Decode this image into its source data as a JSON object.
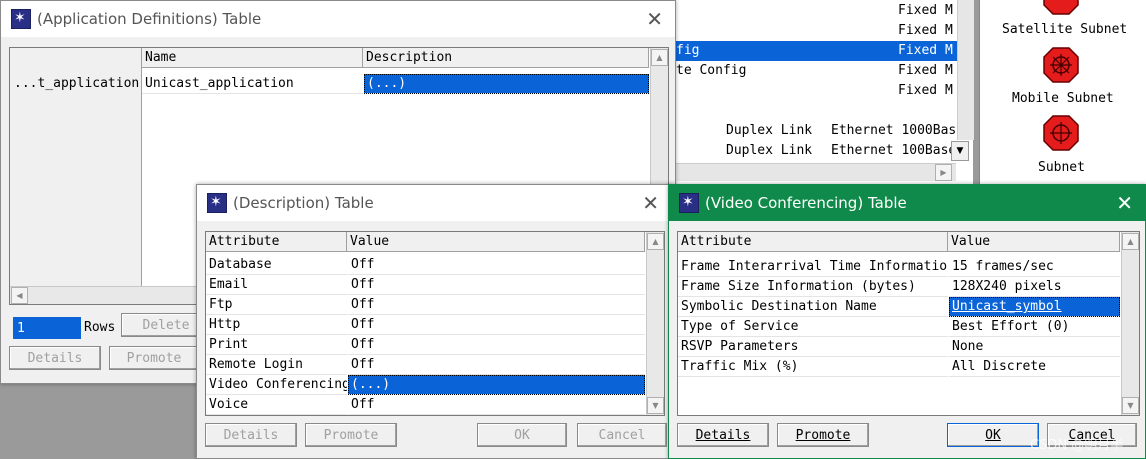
{
  "background_panel": {
    "rows": [
      {
        "left": "",
        "right": "Fixed M"
      },
      {
        "left": "",
        "right": "Fixed M"
      },
      {
        "left": "fig",
        "right": "Fixed M",
        "selected": true
      },
      {
        "left": "te Config",
        "right": "Fixed M"
      },
      {
        "left": "",
        "right": "Fixed M"
      }
    ],
    "links": [
      {
        "name": "Duplex Link",
        "type": "Ethernet 1000Bas"
      },
      {
        "name": "Duplex Link",
        "type": "Ethernet 100Base"
      }
    ]
  },
  "palette": {
    "items": [
      {
        "label": "Satellite Subnet",
        "icon": "satellite-subnet-icon"
      },
      {
        "label": "Mobile Subnet",
        "icon": "mobile-subnet-icon"
      },
      {
        "label": "Subnet",
        "icon": "subnet-icon"
      }
    ]
  },
  "app_defs": {
    "title": "(Application Definitions) Table",
    "col_name": "Name",
    "col_desc": "Description",
    "row_label": "...t_application",
    "row_name": "Unicast_application",
    "row_desc": "(...)",
    "rows_value": "1",
    "rows_label": "Rows",
    "delete_label": "Delete",
    "details_label": "Details",
    "promote_label": "Promote"
  },
  "desc_table": {
    "title": "(Description) Table",
    "col_attr": "Attribute",
    "col_value": "Value",
    "rows": [
      {
        "attr": "Database",
        "value": "Off"
      },
      {
        "attr": "Email",
        "value": "Off"
      },
      {
        "attr": "Ftp",
        "value": "Off"
      },
      {
        "attr": "Http",
        "value": "Off"
      },
      {
        "attr": "Print",
        "value": "Off"
      },
      {
        "attr": "Remote Login",
        "value": "Off"
      },
      {
        "attr": "Video Conferencing",
        "value": "(...)"
      },
      {
        "attr": "Voice",
        "value": "Off"
      }
    ],
    "details_label": "Details",
    "promote_label": "Promote",
    "ok_label": "OK",
    "cancel_label": "Cancel"
  },
  "video_table": {
    "title": "(Video Conferencing) Table",
    "col_attr": "Attribute",
    "col_value": "Value",
    "rows": [
      {
        "attr": "Frame Interarrival Time Information",
        "value": "15 frames/sec"
      },
      {
        "attr": "Frame Size Information (bytes)",
        "value": "128X240 pixels"
      },
      {
        "attr": "Symbolic Destination Name",
        "value": "Unicast_symbol"
      },
      {
        "attr": "Type of Service",
        "value": "Best Effort (0)"
      },
      {
        "attr": "RSVP Parameters",
        "value": "None"
      },
      {
        "attr": "Traffic Mix (%)",
        "value": "All Discrete"
      }
    ],
    "details_label": "Details",
    "promote_label": "Promote",
    "ok_label": "OK",
    "cancel_label": "Cancel"
  },
  "watermark": "CSDN @明月半"
}
